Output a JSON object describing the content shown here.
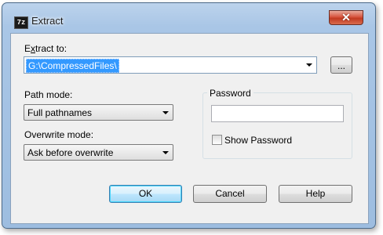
{
  "window": {
    "title": "Extract",
    "app_icon_text": "7z",
    "close_glyph": "✕"
  },
  "extract_to": {
    "label": "Extract to:",
    "mnemonic": "x",
    "value": "G:\\CompressedFiles\\",
    "browse_label": "..."
  },
  "path_mode": {
    "label": "Path mode:",
    "selected": "Full pathnames"
  },
  "overwrite_mode": {
    "label": "Overwrite mode:",
    "selected": "Ask before overwrite"
  },
  "password": {
    "group_title": "Password",
    "value": "",
    "show_label": "Show Password",
    "show_checked": false
  },
  "buttons": {
    "ok": "OK",
    "cancel": "Cancel",
    "help": "Help"
  },
  "icons": {
    "app": "7zip-icon",
    "close": "close-icon",
    "dropdown": "chevron-down-icon"
  }
}
